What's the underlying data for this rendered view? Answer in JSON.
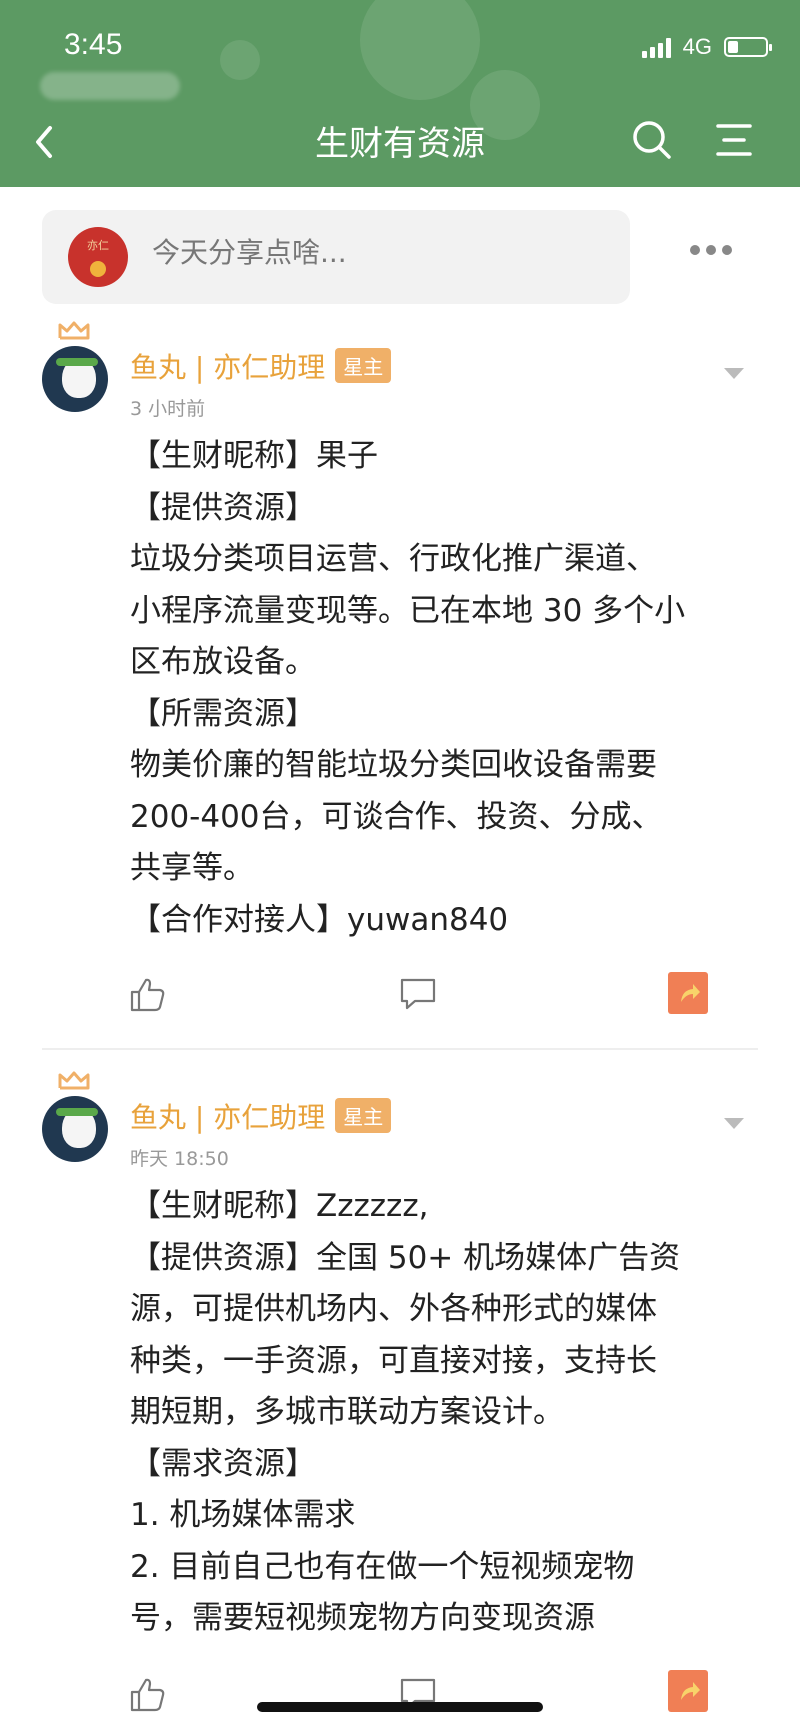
{
  "status_bar": {
    "time": "3:45",
    "network": "4G"
  },
  "header": {
    "title": "生财有资源"
  },
  "composer": {
    "avatar_text": "亦仁",
    "placeholder": "今天分享点啥..."
  },
  "posts": [
    {
      "author": "鱼丸 | 亦仁助理",
      "badge": "星主",
      "time": "3 小时前",
      "lines": [
        "【生财昵称】果子",
        "【提供资源】",
        "垃圾分类项目运营、行政化推广渠道、",
        "小程序流量变现等。已在本地 30 多个小",
        "区布放设备。",
        "【所需资源】",
        "物美价廉的智能垃圾分类回收设备需要",
        "200-400台，可谈合作、投资、分成、",
        "共享等。",
        "【合作对接人】yuwan840"
      ]
    },
    {
      "author": "鱼丸 | 亦仁助理",
      "badge": "星主",
      "time": "昨天 18:50",
      "lines": [
        "【生财昵称】Zzzzzz,",
        "【提供资源】全国 50+ 机场媒体广告资",
        "源，可提供机场内、外各种形式的媒体",
        "种类，一手资源，可直接对接，支持长",
        "期短期，多城市联动方案设计。",
        "【需求资源】",
        "1. 机场媒体需求",
        "2. 目前自己也有在做一个短视频宠物",
        "号，需要短视频宠物方向变现资源"
      ]
    }
  ],
  "icons": {
    "back": "chevron-left-icon",
    "search": "search-icon",
    "menu": "menu-icon",
    "more": "more-icon",
    "like": "thumbs-up-icon",
    "comment": "comment-icon",
    "share": "share-icon"
  },
  "colors": {
    "header_green": "#5c9a63",
    "author_orange": "#e8a23b",
    "badge_orange": "#f0b068",
    "share_orange": "#f07f55"
  }
}
